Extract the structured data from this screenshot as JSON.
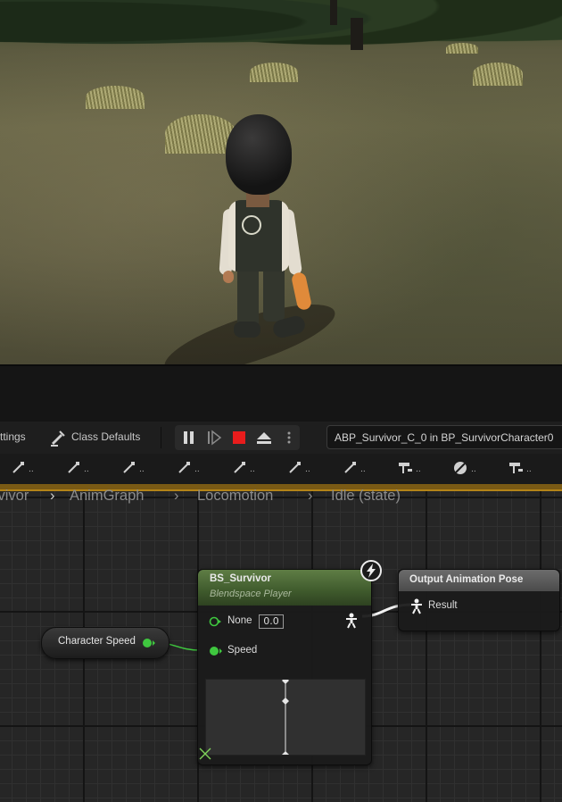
{
  "toolbar": {
    "settings_label": "ttings",
    "class_defaults_label": "Class Defaults",
    "debug_object": "ABP_Survivor_C_0 in BP_SurvivorCharacter0"
  },
  "pins": {
    "ellipsis": ".."
  },
  "breadcrumb": {
    "items": [
      "rvivor",
      "AnimGraph",
      "Locomotion",
      "Idle (state)"
    ]
  },
  "nodes": {
    "blendspace": {
      "title": "BS_Survivor",
      "subtitle": "Blendspace Player",
      "none_label": "None",
      "none_value": "0.0",
      "speed_label": "Speed"
    },
    "output": {
      "title": "Output Animation Pose",
      "result_label": "Result"
    },
    "variable": {
      "label": "Character Speed"
    }
  },
  "colors": {
    "pin_float": "#3fc73f",
    "accent_bar": "#b48418",
    "node_header_green": "#4f6b39",
    "stop_red": "#e81c1c"
  }
}
